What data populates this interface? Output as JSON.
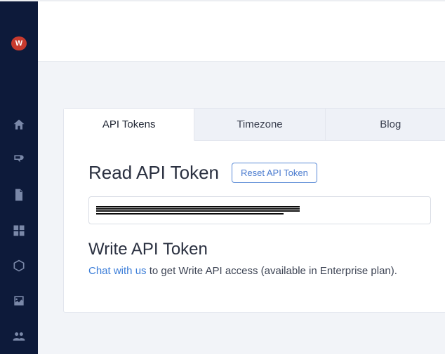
{
  "sidebar": {
    "avatar_letter": "W",
    "items": [
      {
        "name": "home-icon"
      },
      {
        "name": "blog-icon"
      },
      {
        "name": "file-icon"
      },
      {
        "name": "grid-icon"
      },
      {
        "name": "package-icon"
      },
      {
        "name": "image-icon"
      },
      {
        "name": "users-icon"
      }
    ]
  },
  "tabs": [
    {
      "label": "API Tokens",
      "active": true
    },
    {
      "label": "Timezone",
      "active": false
    },
    {
      "label": "Blog",
      "active": false
    }
  ],
  "read_section": {
    "title": "Read API Token",
    "reset_button": "Reset API Token",
    "token_value": "████████████████████████████████"
  },
  "write_section": {
    "title": "Write API Token",
    "chat_link": "Chat with us",
    "desc_suffix": " to get Write API access (available in Enterprise plan)."
  }
}
